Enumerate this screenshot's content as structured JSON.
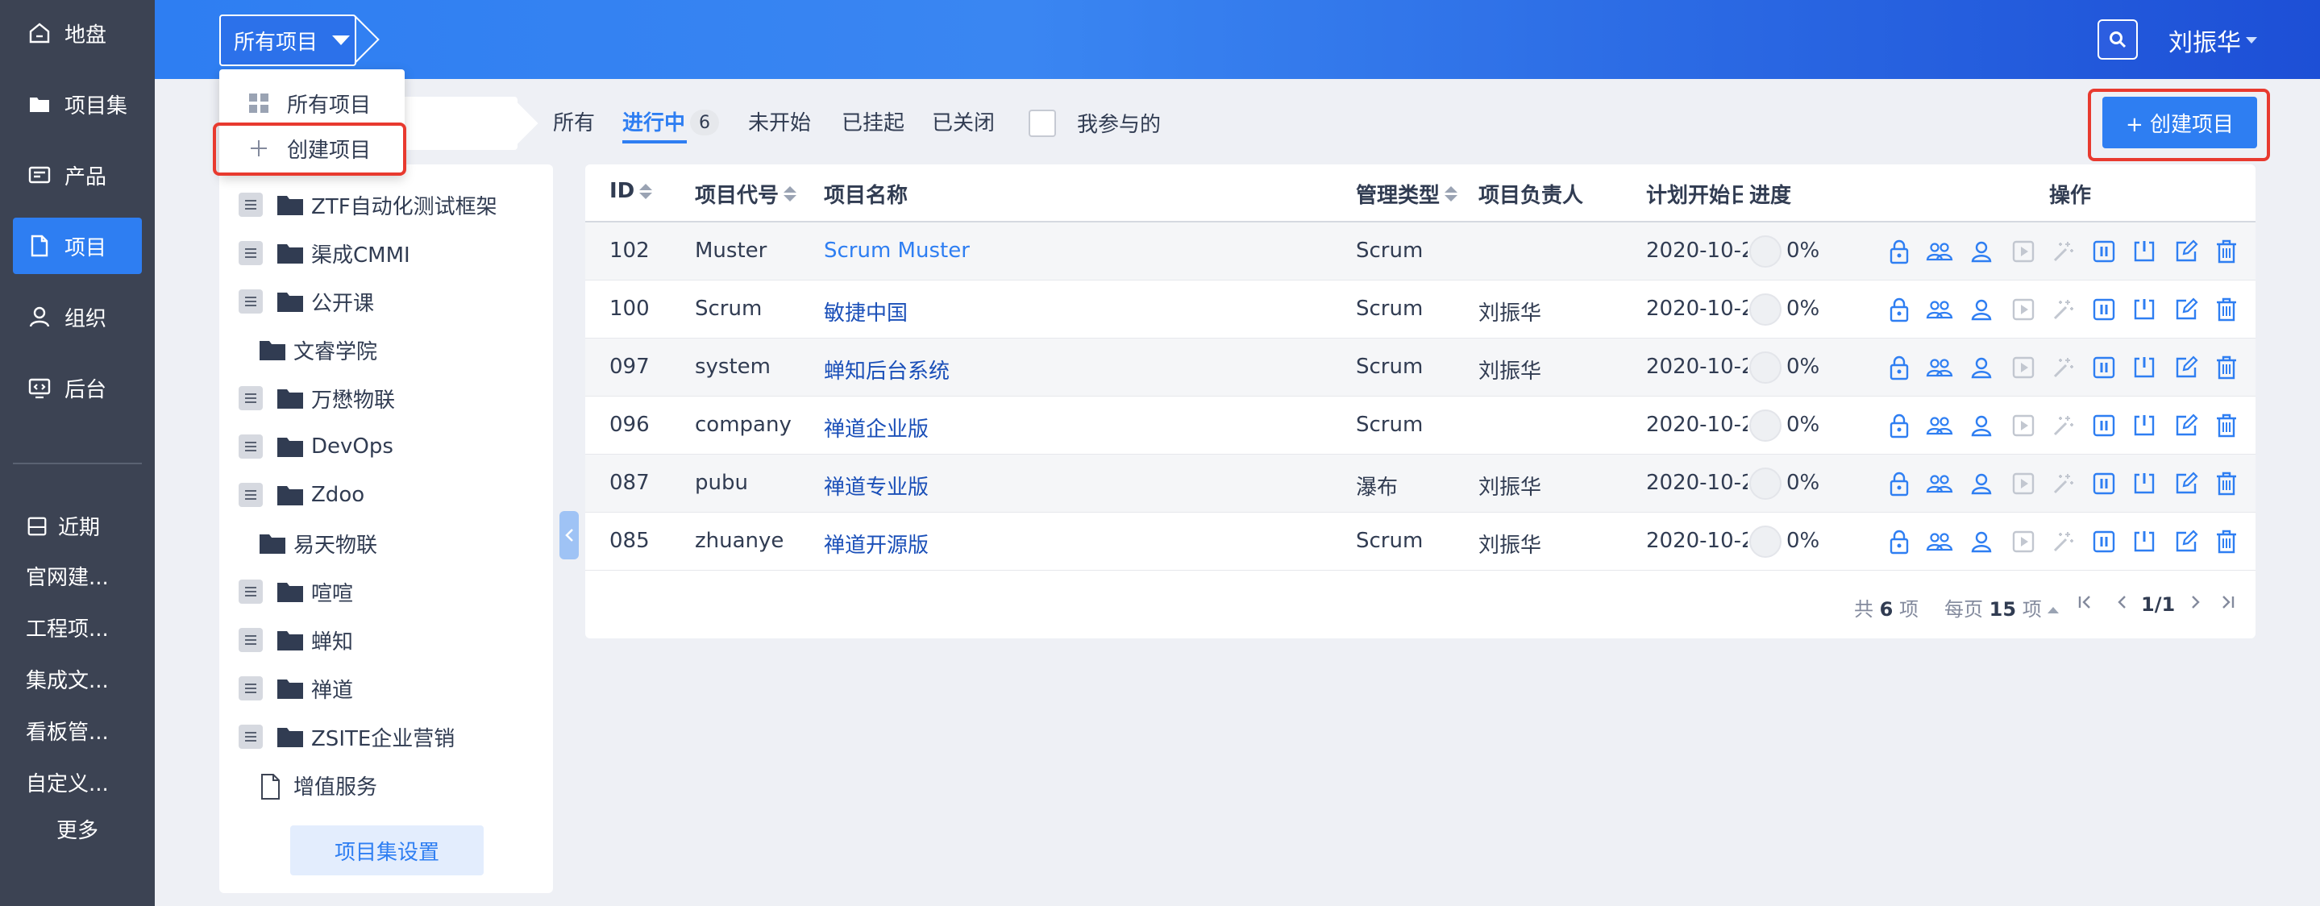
{
  "nav": {
    "items": [
      {
        "label": "地盘",
        "icon": "home-icon"
      },
      {
        "label": "项目集",
        "icon": "folder-icon"
      },
      {
        "label": "产品",
        "icon": "product-icon"
      },
      {
        "label": "项目",
        "icon": "project-icon"
      },
      {
        "label": "组织",
        "icon": "user-icon"
      },
      {
        "label": "后台",
        "icon": "admin-icon"
      }
    ],
    "recent_title": "近期",
    "recent_items": [
      "官网建...",
      "工程项...",
      "集成文...",
      "看板管...",
      "自定义..."
    ],
    "more": "更多"
  },
  "header": {
    "project_switch": "所有项目",
    "user": "刘振华"
  },
  "dropdown": {
    "items": [
      {
        "label": "所有项目",
        "icon": "grid-icon"
      },
      {
        "label": "创建项目",
        "icon": "plus-icon"
      }
    ]
  },
  "tree": {
    "items": [
      {
        "label": "ZTF自动化测试框架",
        "type": "program"
      },
      {
        "label": "渠成CMMI",
        "type": "program"
      },
      {
        "label": "公开课",
        "type": "program"
      },
      {
        "label": "文睿学院",
        "type": "folder"
      },
      {
        "label": "万懋物联",
        "type": "program"
      },
      {
        "label": "DevOps",
        "type": "program"
      },
      {
        "label": "Zdoo",
        "type": "program"
      },
      {
        "label": "易天物联",
        "type": "folder"
      },
      {
        "label": "喧喧",
        "type": "program"
      },
      {
        "label": "蝉知",
        "type": "program"
      },
      {
        "label": "禅道",
        "type": "program"
      },
      {
        "label": "ZSITE企业营销",
        "type": "program"
      },
      {
        "label": "增值服务",
        "type": "file"
      }
    ],
    "settings": "项目集设置"
  },
  "filters": {
    "tabs": [
      "所有",
      "进行中",
      "未开始",
      "已挂起",
      "已关闭"
    ],
    "active_count": "6",
    "involved": "我参与的"
  },
  "create_button": "+ 创建项目",
  "table": {
    "headers": {
      "id": "ID",
      "code": "项目代号",
      "name": "项目名称",
      "type": "管理类型",
      "owner": "项目负责人",
      "begin": "计划开始日",
      "progress": "进度",
      "actions": "操作"
    },
    "rows": [
      {
        "id": "102",
        "code": "Muster",
        "name": "Scrum Muster",
        "type": "Scrum",
        "owner": "",
        "begin": "2020-10-2",
        "progress": "0%"
      },
      {
        "id": "100",
        "code": "Scrum",
        "name": "敏捷中国",
        "type": "Scrum",
        "owner": "刘振华",
        "begin": "2020-10-2",
        "progress": "0%"
      },
      {
        "id": "097",
        "code": "system",
        "name": "蝉知后台系统",
        "type": "Scrum",
        "owner": "刘振华",
        "begin": "2020-10-2",
        "progress": "0%"
      },
      {
        "id": "096",
        "code": "company",
        "name": "禅道企业版",
        "type": "Scrum",
        "owner": "",
        "begin": "2020-10-2",
        "progress": "0%"
      },
      {
        "id": "087",
        "code": "pubu",
        "name": "禅道专业版",
        "type": "瀑布",
        "owner": "刘振华",
        "begin": "2020-10-2",
        "progress": "0%"
      },
      {
        "id": "085",
        "code": "zhuanye",
        "name": "禅道开源版",
        "type": "Scrum",
        "owner": "刘振华",
        "begin": "2020-10-2",
        "progress": "0%"
      }
    ],
    "action_icons": [
      "lock-icon",
      "team-icon",
      "member-icon",
      "play-icon",
      "magic-wand-icon",
      "pause-icon",
      "close-box-icon",
      "edit-icon",
      "trash-icon"
    ]
  },
  "pager": {
    "total_prefix": "共",
    "total": "6",
    "total_suffix": "项",
    "per_page_prefix": "每页",
    "per_page": "15",
    "per_page_suffix": "项",
    "page": "1/1"
  },
  "colors": {
    "accent": "#2e7ef2",
    "nav_bg": "#3c4353",
    "highlight": "#e83a2f"
  }
}
